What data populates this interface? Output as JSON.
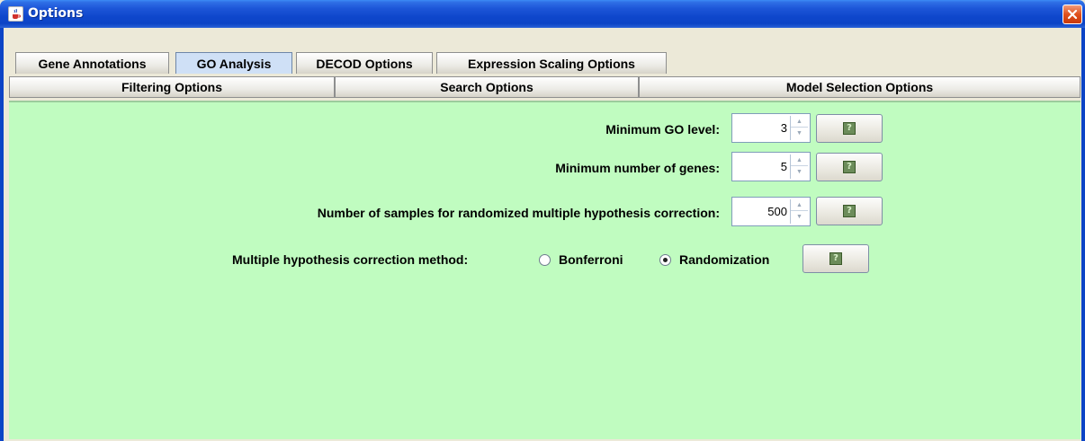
{
  "window": {
    "title": "Options",
    "icon": "java-cup-icon",
    "close_icon": "close-icon"
  },
  "tabs_row1": [
    {
      "label": "Gene Annotations",
      "selected": false
    },
    {
      "label": "GO Analysis",
      "selected": true
    },
    {
      "label": "DECOD Options",
      "selected": false
    },
    {
      "label": "Expression Scaling Options",
      "selected": false
    }
  ],
  "tabs_row2": [
    {
      "label": "Filtering Options"
    },
    {
      "label": "Search Options"
    },
    {
      "label": "Model Selection Options"
    }
  ],
  "go_analysis": {
    "min_go_level": {
      "label": "Minimum GO level:",
      "value": "3"
    },
    "min_genes": {
      "label": "Minimum number of genes:",
      "value": "5"
    },
    "num_samples": {
      "label": "Number of samples for randomized multiple hypothesis correction:",
      "value": "500"
    },
    "correction_method": {
      "label": "Multiple hypothesis correction method:",
      "options": [
        {
          "label": "Bonferroni",
          "selected": false
        },
        {
          "label": "Randomization",
          "selected": true
        }
      ]
    },
    "help_icon": "help-icon"
  },
  "colors": {
    "panel_bg": "#c0fcc0",
    "titlebar": "#0c44c6",
    "selected_tab": "#cfe0f6"
  }
}
